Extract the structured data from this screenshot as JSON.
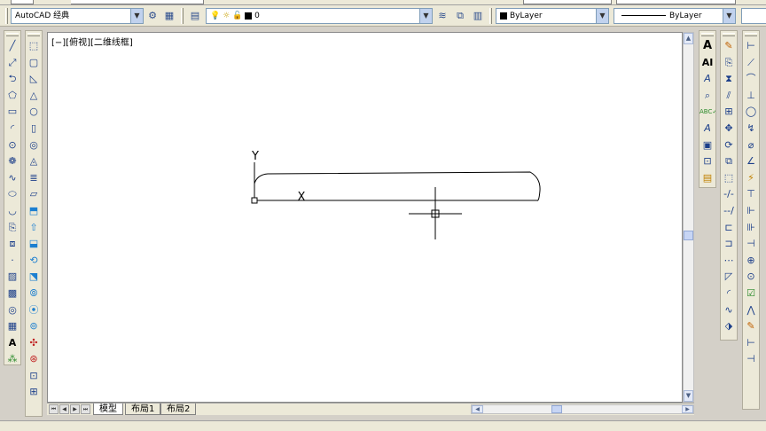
{
  "toolbar": {
    "workspace": "AutoCAD 经典",
    "layer": "0",
    "color": "ByLayer",
    "linetype": "ByLayer"
  },
  "drawing": {
    "viewport_label": "[−][俯视][二维线框]",
    "ucs_y_label": "Y",
    "ucs_x_label": "X"
  },
  "tabs": {
    "model": "模型",
    "layout1": "布局1",
    "layout2": "布局2"
  },
  "icons": {
    "draw_toolbar": [
      "line-icon",
      "construction-line-icon",
      "polyline-icon",
      "polygon-icon",
      "rectangle-icon",
      "arc-icon",
      "circle-icon",
      "revision-cloud-icon",
      "spline-icon",
      "ellipse-icon",
      "ellipse-arc-icon",
      "insert-block-icon",
      "make-block-icon",
      "point-icon",
      "hatch-icon",
      "gradient-icon",
      "region-icon",
      "table-icon",
      "multiline-text-icon",
      "add-selected-icon"
    ],
    "modeling_toolbar": [
      "polysolid-icon",
      "box-icon",
      "wedge-icon",
      "cone-icon",
      "sphere-icon",
      "cylinder-icon",
      "torus-icon",
      "pyramid-icon",
      "helix-icon",
      "planar-surface-icon",
      "extrude-icon",
      "presspull-icon",
      "sweep-icon",
      "revolve-icon",
      "loft-icon",
      "union-icon",
      "subtract-icon",
      "intersect-icon",
      "3d-move-icon",
      "3d-rotate-icon",
      "3d-align-icon",
      "3d-array-icon"
    ],
    "text_toolbar": [
      "multiline-text-icon",
      "single-line-text-icon",
      "edit-text-icon",
      "find-icon",
      "spell-check-icon",
      "text-style-icon",
      "scale-text-icon",
      "justify-text-icon",
      "convert-space-icon"
    ],
    "modify_toolbar": [
      "erase-icon",
      "copy-icon",
      "mirror-icon",
      "offset-icon",
      "array-icon",
      "move-icon",
      "rotate-icon",
      "scale-icon",
      "stretch-icon",
      "trim-icon",
      "extend-icon",
      "break-at-point-icon",
      "break-icon",
      "join-icon",
      "chamfer-icon",
      "fillet-icon",
      "blend-curves-icon",
      "explode-icon"
    ],
    "dimension_toolbar": [
      "linear-dim-icon",
      "aligned-dim-icon",
      "arc-length-icon",
      "ordinate-dim-icon",
      "radius-dim-icon",
      "jogged-icon",
      "diameter-dim-icon",
      "angular-dim-icon",
      "quick-dim-icon",
      "baseline-dim-icon",
      "continue-dim-icon",
      "dim-space-icon",
      "dim-break-icon",
      "tolerance-icon",
      "center-mark-icon",
      "inspection-icon",
      "jogged-linear-icon",
      "dim-edit-icon",
      "dim-text-edit-icon",
      "dim-update-icon"
    ]
  }
}
